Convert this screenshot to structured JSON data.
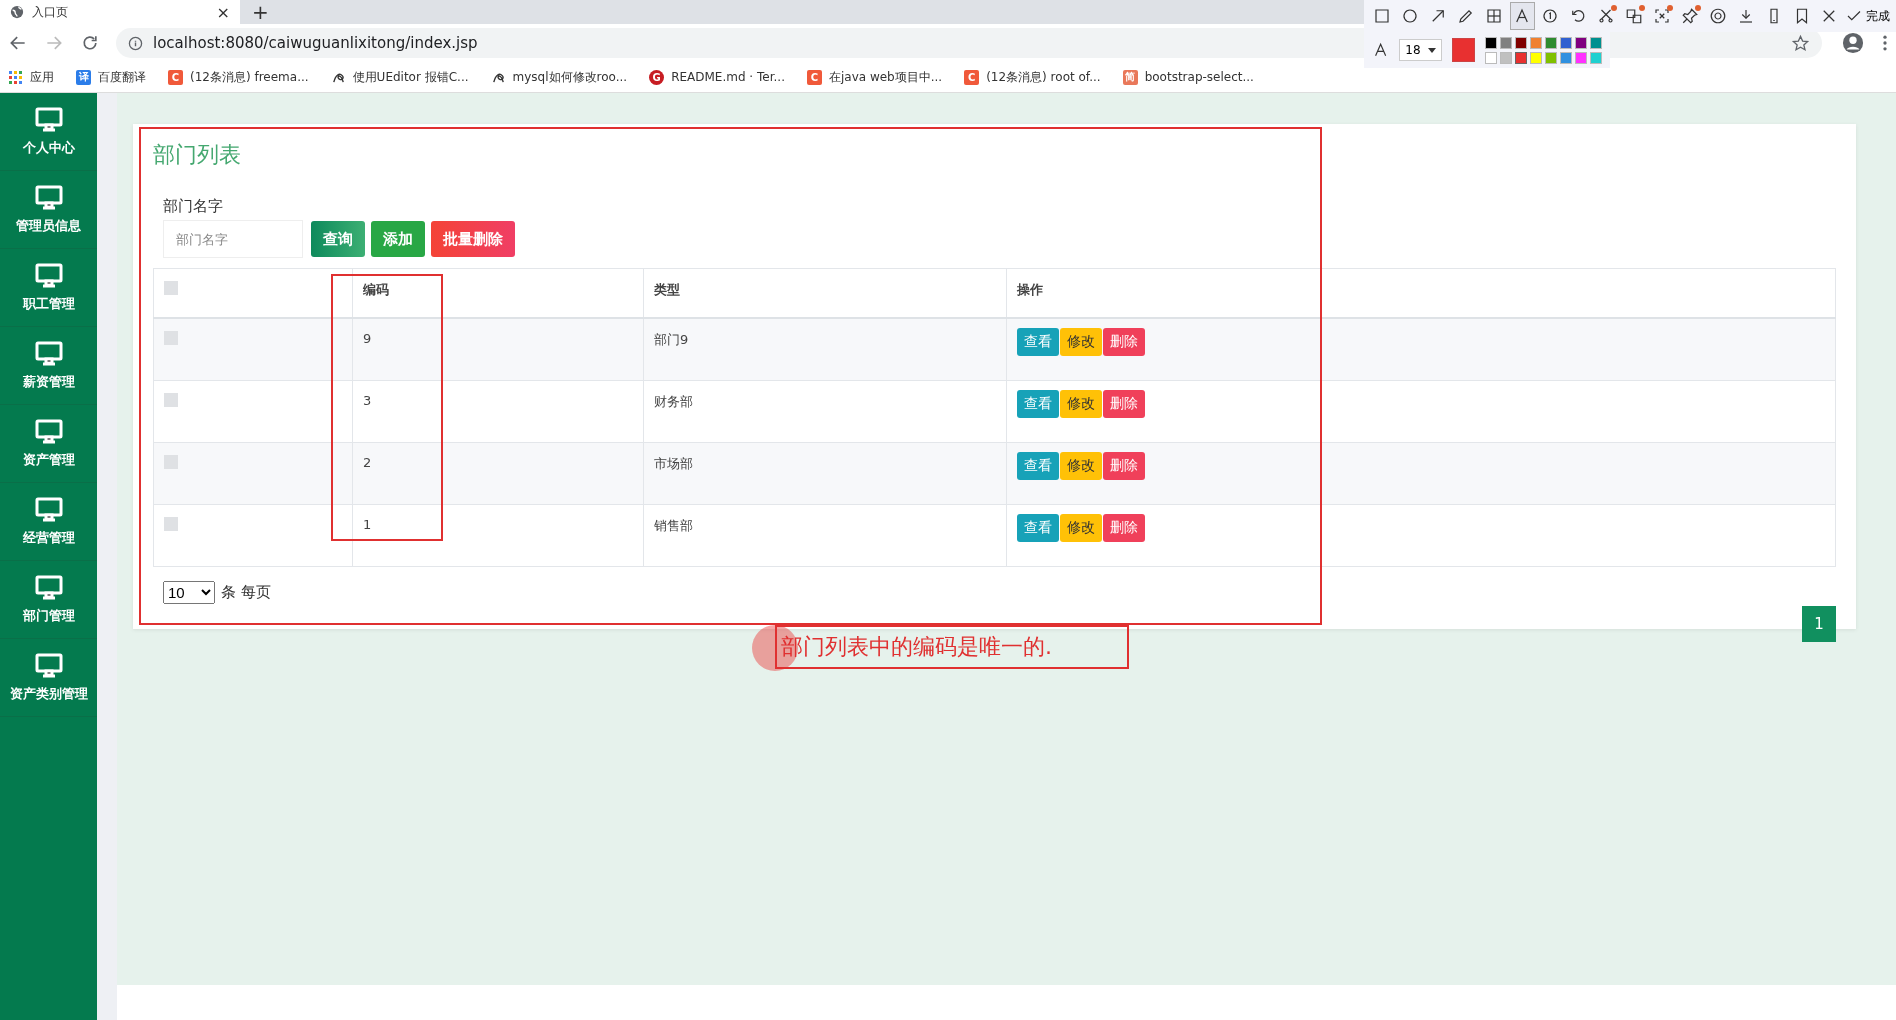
{
  "browser": {
    "tab": {
      "title": "入口页",
      "close": "×"
    },
    "new_tab": "+",
    "url": "localhost:8080/caiwuguanlixitong/index.jsp",
    "bookmarks": [
      {
        "kind": "apps",
        "label": "应用"
      },
      {
        "kind": "letter",
        "icon": "译",
        "color": "#2b7de9",
        "label": "百度翻译"
      },
      {
        "kind": "letter",
        "icon": "C",
        "color": "#f0593a",
        "label": "(12条消息) freema..."
      },
      {
        "kind": "swirl",
        "label": "使用UEditor 报错C..."
      },
      {
        "kind": "swirl",
        "label": "mysql如何修改roo..."
      },
      {
        "kind": "round",
        "icon": "G",
        "color": "#c71d23",
        "label": "README.md · Ter..."
      },
      {
        "kind": "letter",
        "icon": "C",
        "color": "#f0593a",
        "label": "在java web项目中..."
      },
      {
        "kind": "letter",
        "icon": "C",
        "color": "#f0593a",
        "label": "(12条消息) root of..."
      },
      {
        "kind": "letter",
        "icon": "简",
        "color": "#e9785a",
        "label": "bootstrap-select..."
      }
    ]
  },
  "sidebar": {
    "items": [
      {
        "label": "个人中心"
      },
      {
        "label": "管理员信息"
      },
      {
        "label": "职工管理"
      },
      {
        "label": "薪资管理"
      },
      {
        "label": "资产管理"
      },
      {
        "label": "经营管理"
      },
      {
        "label": "部门管理"
      },
      {
        "label": "资产类别管理"
      }
    ]
  },
  "panel": {
    "title": "部门列表",
    "search_label": "部门名字",
    "search": {
      "placeholder": "部门名字"
    },
    "buttons": [
      {
        "kind": "primary",
        "label": "查询"
      },
      {
        "kind": "success",
        "label": "添加"
      },
      {
        "kind": "danger",
        "label": "批量删除"
      }
    ],
    "table": {
      "select_all_checked": false,
      "columns": [
        "编码",
        "类型",
        "操作"
      ],
      "rows": [
        {
          "checked": false,
          "code": "9",
          "type": "部门9",
          "actions": [
            {
              "kind": "info",
              "label": "查看"
            },
            {
              "kind": "warning",
              "label": "修改"
            },
            {
              "kind": "danger",
              "label": "删除"
            }
          ]
        },
        {
          "checked": false,
          "code": "3",
          "type": "财务部",
          "actions": [
            {
              "kind": "info",
              "label": "查看"
            },
            {
              "kind": "warning",
              "label": "修改"
            },
            {
              "kind": "danger",
              "label": "删除"
            }
          ]
        },
        {
          "checked": false,
          "code": "2",
          "type": "市场部",
          "actions": [
            {
              "kind": "info",
              "label": "查看"
            },
            {
              "kind": "warning",
              "label": "修改"
            },
            {
              "kind": "danger",
              "label": "删除"
            }
          ]
        },
        {
          "checked": false,
          "code": "1",
          "type": "销售部",
          "actions": [
            {
              "kind": "info",
              "label": "查看"
            },
            {
              "kind": "warning",
              "label": "修改"
            },
            {
              "kind": "danger",
              "label": "删除"
            }
          ]
        }
      ]
    },
    "page_size": "10",
    "page_size_label": "条 每页",
    "pages": [
      {
        "label": "1",
        "selected": true
      }
    ]
  },
  "annotation": {
    "note": "部门列表中的编码是唯一的."
  },
  "capture_toolbar": {
    "tools": [
      {
        "kind": "rectangle",
        "selected": false,
        "badge": false
      },
      {
        "kind": "ellipse",
        "selected": false,
        "badge": false
      },
      {
        "kind": "arrow",
        "selected": false,
        "badge": false
      },
      {
        "kind": "pencil",
        "selected": false,
        "badge": false
      },
      {
        "kind": "mosaic",
        "selected": false,
        "badge": false
      },
      {
        "kind": "text",
        "selected": true,
        "badge": false
      },
      {
        "kind": "number",
        "selected": false,
        "badge": false
      },
      {
        "kind": "undo",
        "selected": false,
        "badge": false
      },
      {
        "kind": "scissors",
        "selected": false,
        "badge": true
      },
      {
        "kind": "translate",
        "selected": false,
        "badge": true
      },
      {
        "kind": "ocr",
        "selected": false,
        "badge": true
      },
      {
        "kind": "pin",
        "selected": false,
        "badge": true
      },
      {
        "kind": "record",
        "selected": false,
        "badge": false
      },
      {
        "kind": "download",
        "selected": false,
        "badge": false
      },
      {
        "kind": "phone",
        "selected": false,
        "badge": false
      },
      {
        "kind": "bookmark",
        "selected": false,
        "badge": false
      },
      {
        "kind": "close",
        "selected": false,
        "badge": false
      }
    ],
    "done": "完成",
    "font_size": "18",
    "swatches": [
      {
        "color": "#000000",
        "selected": false
      },
      {
        "color": "#808080",
        "selected": false
      },
      {
        "color": "#800000",
        "selected": false
      },
      {
        "color": "#f08030",
        "selected": false
      },
      {
        "color": "#2e8b30",
        "selected": false
      },
      {
        "color": "#3060d0",
        "selected": false
      },
      {
        "color": "#800080",
        "selected": false
      },
      {
        "color": "#009090",
        "selected": false
      },
      {
        "color": "#ffffff",
        "selected": false
      },
      {
        "color": "#c0c0c0",
        "selected": false
      },
      {
        "color": "#e83030",
        "selected": true
      },
      {
        "color": "#ffff00",
        "selected": false
      },
      {
        "color": "#80c000",
        "selected": false
      },
      {
        "color": "#3090e0",
        "selected": false
      },
      {
        "color": "#ff30ff",
        "selected": false
      },
      {
        "color": "#20d0d0",
        "selected": false
      }
    ]
  }
}
